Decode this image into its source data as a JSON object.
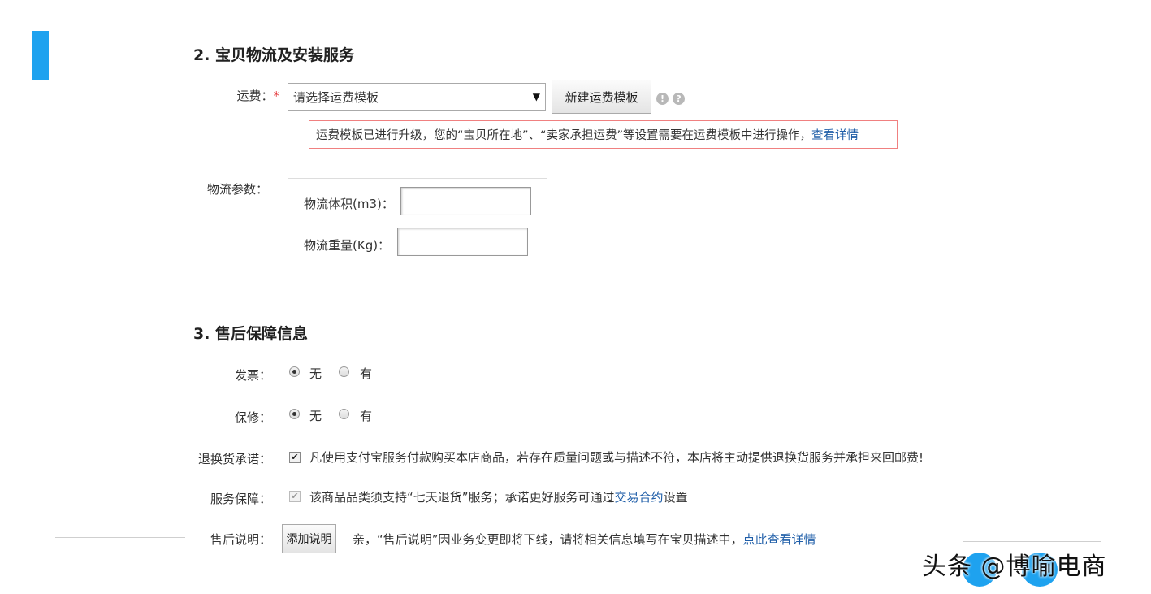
{
  "section2": {
    "title": "2. 宝贝物流及安装服务",
    "shipping": {
      "label": "运费：",
      "required_mark": "*",
      "select_value": "请选择运费模板",
      "new_template_button": "新建运费模板",
      "notice_text": "运费模板已进行升级，您的“宝贝所在地”、“卖家承担运费”等设置需要在运费模板中进行操作，",
      "notice_link": "查看详情"
    },
    "logistics": {
      "label": "物流参数：",
      "volume_label": "物流体积(m3)：",
      "volume_value": "",
      "weight_label": "物流重量(Kg)：",
      "weight_value": ""
    }
  },
  "section3": {
    "title": "3. 售后保障信息",
    "invoice": {
      "label": "发票：",
      "options": [
        "无",
        "有"
      ],
      "selected": "无"
    },
    "warranty": {
      "label": "保修：",
      "options": [
        "无",
        "有"
      ],
      "selected": "无"
    },
    "return_promise": {
      "label": "退换货承诺：",
      "checked": true,
      "text": "凡使用支付宝服务付款购买本店商品，若存在质量问题或与描述不符，本店将主动提供退换货服务并承担来回邮费!"
    },
    "service_guarantee": {
      "label": "服务保障：",
      "checked": true,
      "text_before": "该商品品类须支持“七天退货”服务；承诺更好服务可通过",
      "link": "交易合约",
      "text_after": "设置"
    },
    "after_sales_note": {
      "label": "售后说明：",
      "button": "添加说明",
      "text": "亲，“售后说明”因业务变更即将下线，请将相关信息填写在宝贝描述中，",
      "link": "点此查看详情"
    }
  },
  "watermark": "头条 @博喻电商",
  "colors": {
    "accent": "#1ea2ef",
    "link": "#1f5ea8",
    "required": "#e4393c",
    "notice_border": "#f08080"
  }
}
